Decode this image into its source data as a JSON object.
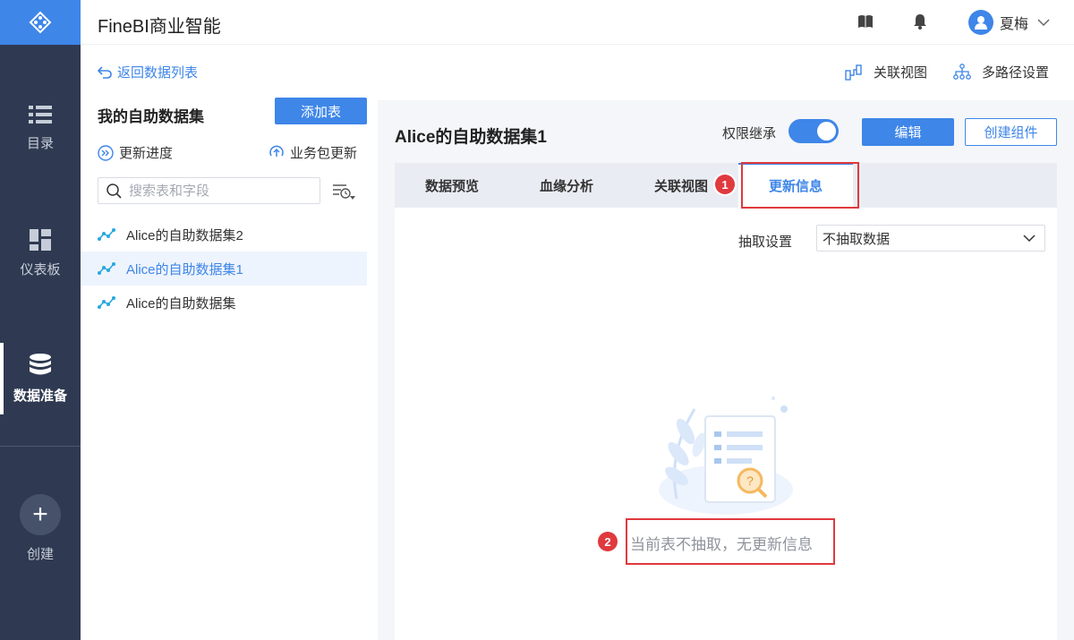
{
  "colors": {
    "accent": "#3e86e8",
    "nav_bg": "#2f3a52",
    "annotation": "#e0393e"
  },
  "nav": {
    "items": [
      {
        "label": "目录",
        "icon": "list-icon"
      },
      {
        "label": "仪表板",
        "icon": "dashboard-icon"
      },
      {
        "label": "数据准备",
        "icon": "database-icon",
        "active": true
      },
      {
        "label": "创建",
        "icon": "plus-icon"
      }
    ]
  },
  "header": {
    "title": "FineBI商业智能",
    "user_name": "夏梅"
  },
  "left_panel": {
    "back_label": "返回数据列表",
    "title": "我的自助数据集",
    "add_button": "添加表",
    "update_progress": "更新进度",
    "package_update": "业务包更新",
    "search_placeholder": "搜索表和字段",
    "datasets": [
      {
        "name": "Alice的自助数据集2",
        "selected": false
      },
      {
        "name": "Alice的自助数据集1",
        "selected": true
      },
      {
        "name": "Alice的自助数据集",
        "selected": false
      }
    ]
  },
  "sub_header": {
    "relation_view": "关联视图",
    "multipath_settings": "多路径设置"
  },
  "main": {
    "dataset_title": "Alice的自助数据集1",
    "permission_label": "权限继承",
    "permission_on": true,
    "edit_button": "编辑",
    "create_component_button": "创建组件",
    "tabs": [
      {
        "label": "数据预览"
      },
      {
        "label": "血缘分析"
      },
      {
        "label": "关联视图"
      },
      {
        "label": "更新信息",
        "active": true
      }
    ],
    "extract_label": "抽取设置",
    "extract_value": "不抽取数据",
    "empty_message": "当前表不抽取，无更新信息"
  },
  "annotations": [
    "1",
    "2"
  ]
}
